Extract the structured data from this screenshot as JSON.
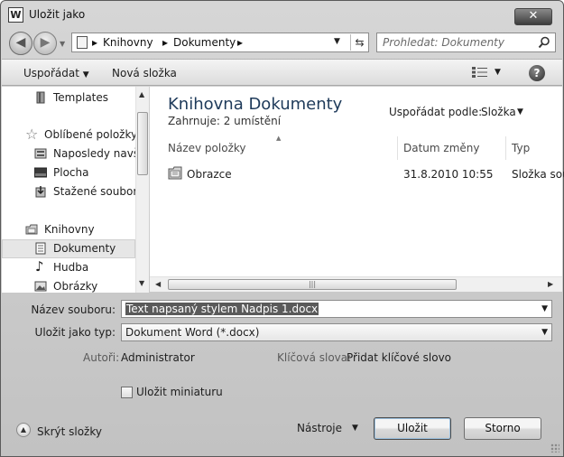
{
  "window": {
    "title": "Uložit jako",
    "app_icon": "W",
    "close": "✕"
  },
  "address": {
    "crumbs": [
      "Knihovny",
      "Dokumenty"
    ]
  },
  "search": {
    "placeholder": "Prohledat: Dokumenty"
  },
  "toolbar": {
    "organize": "Uspořádat",
    "new_folder": "Nová složka",
    "help": "?"
  },
  "nav": {
    "items": [
      {
        "label": "Templates",
        "icon": "templates-folder-icon"
      },
      {
        "label": "Oblíbené položky",
        "icon": "star-icon"
      },
      {
        "label": "Naposledy navští",
        "icon": "recent-places-icon"
      },
      {
        "label": "Plocha",
        "icon": "desktop-icon"
      },
      {
        "label": "Stažené soubory",
        "icon": "downloads-icon"
      },
      {
        "label": "Knihovny",
        "icon": "libraries-icon"
      },
      {
        "label": "Dokumenty",
        "icon": "document-icon",
        "selected": true
      },
      {
        "label": "Hudba",
        "icon": "music-icon"
      },
      {
        "label": "Obrázky",
        "icon": "pictures-icon"
      }
    ]
  },
  "content": {
    "title": "Knihovna Dokumenty",
    "subtitle_label": "Zahrnuje:",
    "subtitle_link": "2 umístění",
    "arrange_label": "Uspořádat podle:",
    "arrange_value": "Složka",
    "columns": [
      "Název položky",
      "Datum změny",
      "Typ"
    ],
    "rows": [
      {
        "name": "Obrazce",
        "date": "31.8.2010 10:55",
        "type": "Složka sou"
      }
    ]
  },
  "form": {
    "filename_label": "Název souboru:",
    "filename_value": "Text napsaný stylem Nadpis 1.docx",
    "type_label": "Uložit jako typ:",
    "type_value": "Dokument Word (*.docx)",
    "authors_label": "Autoři:",
    "authors_value": "Administrator",
    "keywords_label": "Klíčová slova:",
    "keywords_value": "Přidat klíčové slovo",
    "thumbnail_label": "Uložit miniaturu",
    "thumbnail_checked": false
  },
  "footer": {
    "hide_folders": "Skrýt složky",
    "tools": "Nástroje",
    "save": "Uložit",
    "cancel": "Storno"
  }
}
